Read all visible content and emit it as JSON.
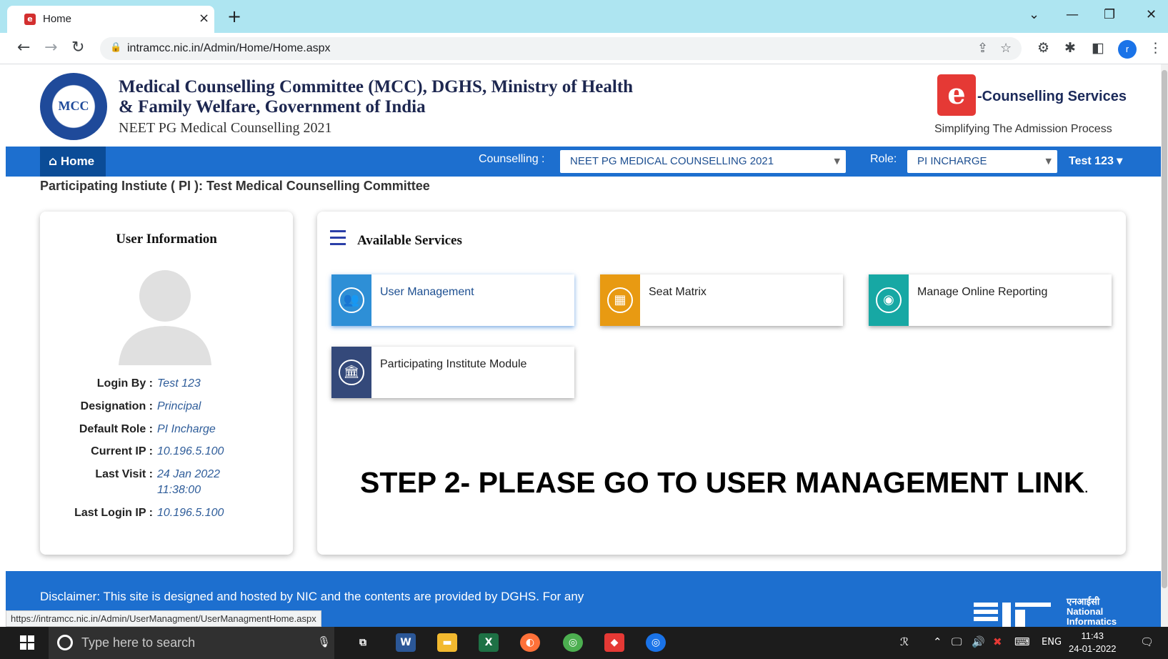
{
  "browser": {
    "tab_title": "Home",
    "tab_close": "×",
    "new_tab": "+",
    "url": "intramcc.nic.in/Admin/Home/Home.aspx",
    "status_url": "https://intramcc.nic.in/Admin/UserManagment/UserManagmentHome.aspx",
    "profile_initial": "r"
  },
  "header": {
    "org_line1": "Medical Counselling Committee (MCC), DGHS, Ministry of Health",
    "org_line2": "& Family Welfare, Government of India",
    "org_sub": "NEET PG Medical Counselling 2021",
    "mcc_logo_text": "MCC",
    "ec_logo_letter": "e",
    "ec_title": "-Counselling Services",
    "ec_subtitle": "Simplifying The Admission Process"
  },
  "navbar": {
    "home_label": "Home",
    "counselling_label": "Counselling :",
    "counselling_value": "NEET PG MEDICAL COUNSELLING 2021",
    "role_label": "Role:",
    "role_value": "PI INCHARGE",
    "user_menu": "Test 123 ▾"
  },
  "pi_line": "Participating Instiute ( PI ): Test Medical Counselling Committee",
  "user_info": {
    "title": "User Information",
    "rows": [
      {
        "key": "Login By :",
        "value": "Test 123"
      },
      {
        "key": "Designation :",
        "value": "Principal"
      },
      {
        "key": "Default Role :",
        "value": "PI Incharge"
      },
      {
        "key": "Current IP :",
        "value": "10.196.5.100"
      },
      {
        "key": "Last Visit :",
        "value": "24 Jan 2022",
        "value2": "11:38:00"
      },
      {
        "key": "Last Login IP :",
        "value": "10.196.5.100"
      }
    ]
  },
  "services": {
    "title": "Available Services",
    "items": [
      {
        "label": "User Management",
        "color": "#2e8fd6",
        "icon": "users-icon",
        "glyph": "👥"
      },
      {
        "label": "Seat Matrix",
        "color": "#e89a12",
        "icon": "grid-icon",
        "glyph": "▦"
      },
      {
        "label": "Manage Online Reporting",
        "color": "#17a8a4",
        "icon": "disc-icon",
        "glyph": "◉"
      },
      {
        "label": "Participating Institute Module",
        "color": "#34497a",
        "icon": "institution-icon",
        "glyph": "🏛"
      }
    ],
    "step_text": "STEP 2- PLEASE GO TO USER MANAGEMENT LINK",
    "step_dot": "."
  },
  "footer": {
    "disclaimer": "Disclaimer: This site is designed and hosted by NIC and the contents are provided by DGHS. For any",
    "nic_hindi": "एनआईसी",
    "nic_line1": "National",
    "nic_line2": "Informatics"
  },
  "taskbar": {
    "search_placeholder": "Type here to search",
    "lang": "ENG",
    "time": "11:43",
    "date": "24-01-2022"
  },
  "colors": {
    "nav_blue": "#1d6fcf",
    "home_dark": "#0b4c97",
    "tab_bar": "#aee5f1"
  }
}
